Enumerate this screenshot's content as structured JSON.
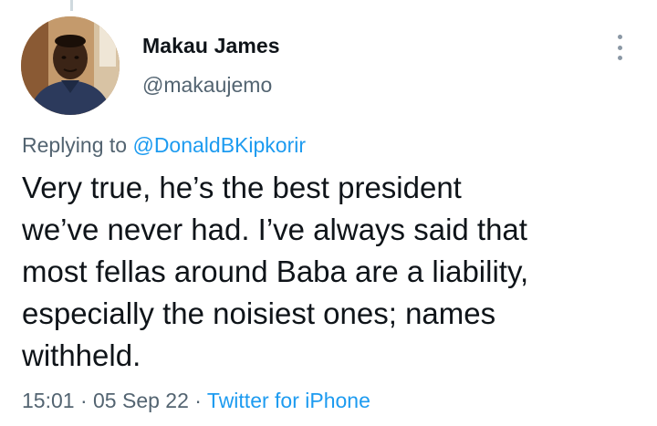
{
  "author": {
    "name": "Makau James",
    "handle": "@makaujemo",
    "avatar_icon": "user-avatar-photo"
  },
  "reply": {
    "prefix": "Replying to ",
    "mention": "@DonaldBKipkorir"
  },
  "tweet": {
    "lines": [
      "Very true, he’s the best president",
      "we’ve never had. I’ve always said that",
      "most fellas around Baba are a liability,",
      "especially the noisiest ones; names",
      "withheld."
    ]
  },
  "meta": {
    "time": "15:01",
    "separator": " · ",
    "date": "05 Sep 22",
    "source": "Twitter for iPhone"
  },
  "icons": {
    "more": "more-vertical-icon"
  },
  "colors": {
    "text": "#0f1419",
    "secondary": "#536471",
    "link": "#1d9bf0"
  }
}
